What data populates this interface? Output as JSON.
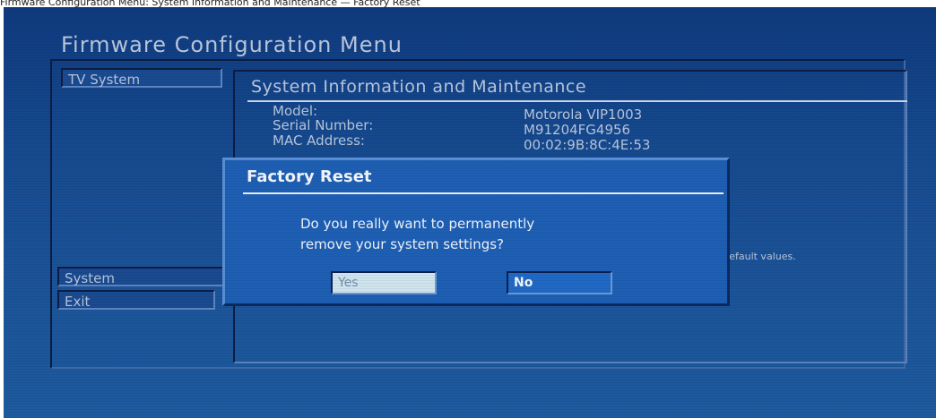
{
  "caption": "Firmware Configuration Menu: System Information and Maintenance — Factory Reset",
  "title": "Firmware Configuration Menu",
  "menu": {
    "tv_system": "TV System",
    "system": "System",
    "exit": "Exit"
  },
  "panel": {
    "title": "System Information and Maintenance",
    "info": [
      {
        "label": "Model:",
        "value": "Motorola VIP1003"
      },
      {
        "label": "Serial Number:",
        "value": "M91204FG4956"
      },
      {
        "label": "MAC Address:",
        "value": "00:02:9B:8C:4E:53"
      }
    ],
    "background_note": "factory default values.",
    "background_note_tail": "s."
  },
  "dialog": {
    "title": "Factory Reset",
    "message_line1": "Do you really want to permanently",
    "message_line2": "remove your system settings?",
    "yes_label": "Yes",
    "no_label": "No"
  }
}
